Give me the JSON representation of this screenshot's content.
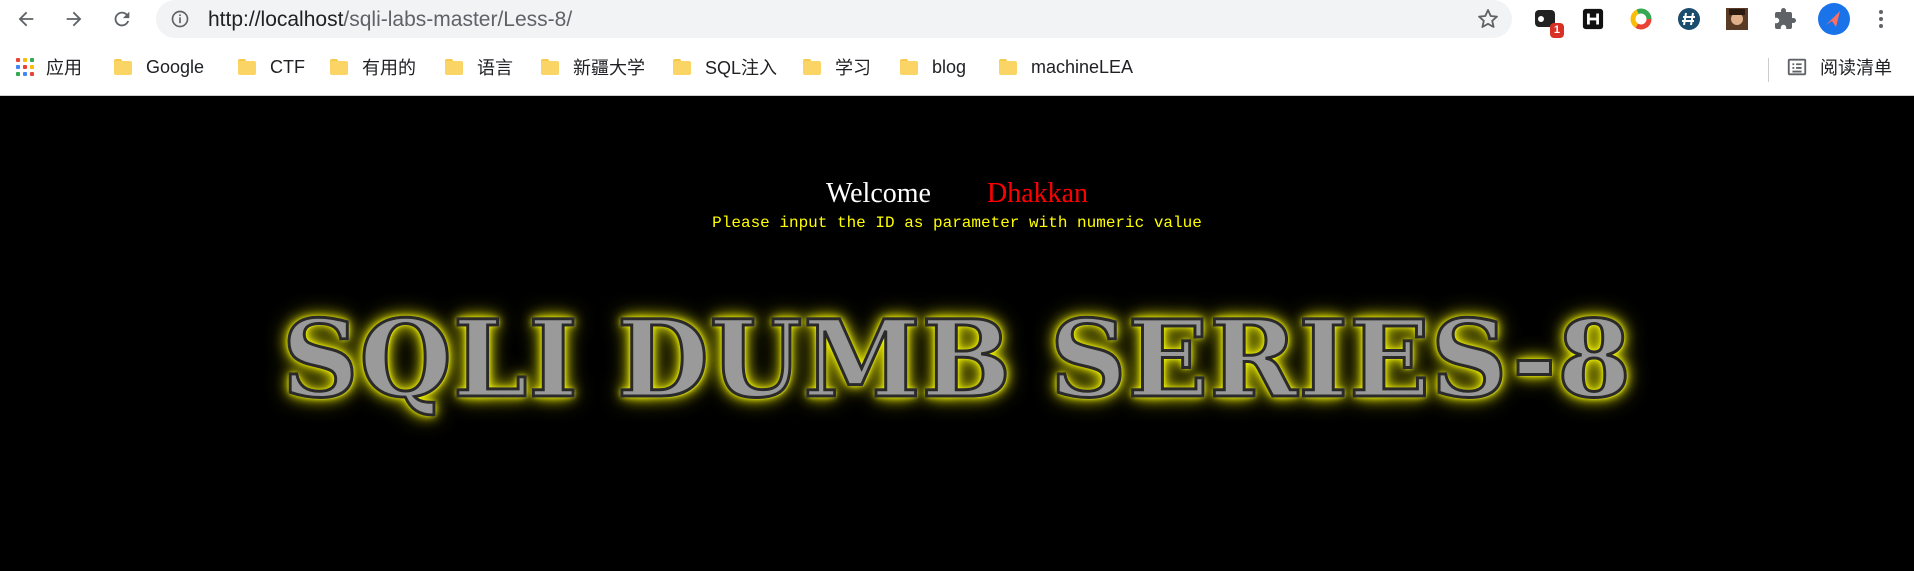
{
  "browser": {
    "url_host": "http://localhost",
    "url_path": "/sqli-labs-master/Less-8/",
    "extension_badge": "1",
    "bookmarks": [
      {
        "label": "应用",
        "type": "apps"
      },
      {
        "label": "Google",
        "type": "folder"
      },
      {
        "label": "CTF",
        "type": "folder"
      },
      {
        "label": "有用的",
        "type": "folder"
      },
      {
        "label": "语言",
        "type": "folder"
      },
      {
        "label": "新疆大学",
        "type": "folder"
      },
      {
        "label": "SQL注入",
        "type": "folder"
      },
      {
        "label": "学习",
        "type": "folder"
      },
      {
        "label": "blog",
        "type": "folder"
      },
      {
        "label": "machineLEA",
        "type": "folder"
      }
    ],
    "reading_list_label": "阅读清单"
  },
  "page": {
    "welcome_label": "Welcome",
    "welcome_name": "Dhakkan",
    "prompt": "Please input the ID as parameter with numeric value",
    "banner": "SQLI DUMB SERIES-8"
  },
  "colors": {
    "background": "#000000",
    "welcome": "#ffffff",
    "name": "#ff0000",
    "prompt": "#ffff00",
    "banner_glow": "#ffff00"
  }
}
